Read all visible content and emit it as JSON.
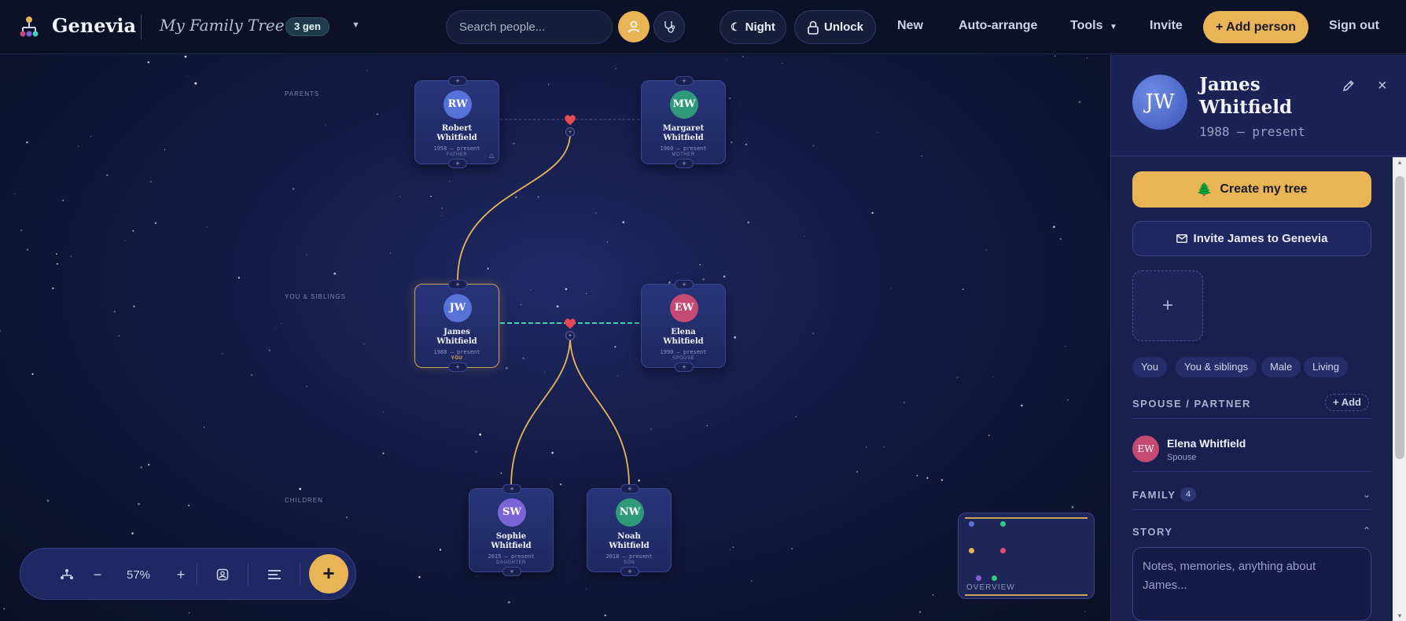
{
  "header": {
    "brand": "Genevia",
    "tree_name": "My Family Tree",
    "gen_badge": "3 gen",
    "search_placeholder": "Search people...",
    "night_label": "Night",
    "unlock_label": "Unlock",
    "new_label": "New",
    "auto_arrange_label": "Auto-arrange",
    "tools_label": "Tools",
    "invite_label": "Invite",
    "add_person_label": "+ Add person",
    "sign_out_label": "Sign out"
  },
  "canvas": {
    "row_labels": {
      "parents": "PARENTS",
      "you_siblings": "YOU & SIBLINGS",
      "children": "CHILDREN"
    },
    "people": [
      {
        "initials": "RW",
        "first": "Robert",
        "last": "Whitfield",
        "dates": "1958 – present",
        "role": "FATHER",
        "color": "#5672d6"
      },
      {
        "initials": "MW",
        "first": "Margaret",
        "last": "Whitfield",
        "dates": "1960 – present",
        "role": "MOTHER",
        "color": "#2f9a7a"
      },
      {
        "initials": "JW",
        "first": "James",
        "last": "Whitfield",
        "dates": "1988 – present",
        "role": "YOU",
        "color": "#5672d6"
      },
      {
        "initials": "EW",
        "first": "Elena",
        "last": "Whitfield",
        "dates": "1990 – present",
        "role": "SPOUSE",
        "color": "#c44a74"
      },
      {
        "initials": "SW",
        "first": "Sophie",
        "last": "Whitfield",
        "dates": "2015 – present",
        "role": "DAUGHTER",
        "color": "#7b64d6"
      },
      {
        "initials": "NW",
        "first": "Noah",
        "last": "Whitfield",
        "dates": "2018 – present",
        "role": "SON",
        "color": "#2f9a7a"
      }
    ],
    "plus": "+"
  },
  "zoombar": {
    "zoom_out": "−",
    "zoom_level": "57%",
    "zoom_in": "+",
    "add": "+"
  },
  "minimap": {
    "label": "OVERVIEW"
  },
  "panel": {
    "initials": "JW",
    "name": "James Whitfield",
    "dates": "1988 – present",
    "create_tree_label": "Create my tree",
    "invite_label": "Invite James to Genevia",
    "photo_add": "+",
    "tags": [
      "You",
      "You & siblings",
      "Male",
      "Living"
    ],
    "spouse_section": "SPOUSE / PARTNER",
    "add_label": "+ Add",
    "spouse": {
      "initials": "EW",
      "name": "Elena Whitfield",
      "role": "Spouse"
    },
    "family_section": "FAMILY",
    "family_count": "4",
    "story_section": "STORY",
    "story_placeholder": "Notes, memories, anything about James..."
  },
  "colors": {
    "accent": "#e8b455",
    "teal_link": "#3fd1b8",
    "heart": "#e84a55",
    "background": "#0d1230"
  }
}
